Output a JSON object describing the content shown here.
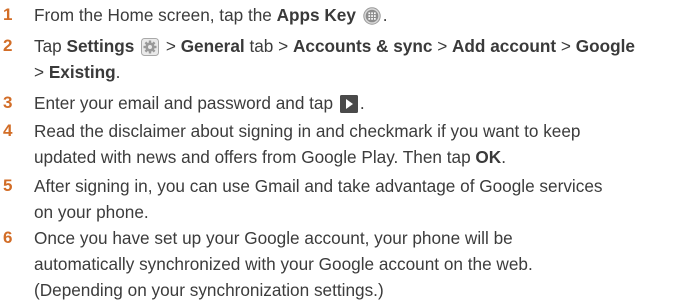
{
  "icons": {
    "apps_key": "apps-grid-icon",
    "settings": "settings-gear-icon",
    "next": "next-arrow-icon"
  },
  "colors": {
    "step_number": "#d26d27",
    "text": "#3c3c3c"
  },
  "steps": [
    {
      "number": "1",
      "line1_pre": "From the Home screen, tap the ",
      "apps_key": "Apps Key",
      "line1_post": "."
    },
    {
      "number": "2",
      "tap": "Tap ",
      "settings": "Settings",
      "sep1": " > ",
      "general": "General",
      "tab": " tab > ",
      "accounts": "Accounts & sync",
      "sep2": " > ",
      "add_account": "Add account",
      "sep3": " > ",
      "google": "Google",
      "sep4": "> ",
      "existing": "Existing",
      "end": "."
    },
    {
      "number": "3",
      "line1_pre": "Enter your email and password and tap ",
      "line1_post": "."
    },
    {
      "number": "4",
      "line1": "Read the disclaimer about signing in and checkmark if you want to keep",
      "line2_pre": "updated with news and offers from Google Play. Then tap ",
      "ok": "OK",
      "line2_post": "."
    },
    {
      "number": "5",
      "line1": "After signing in, you can use Gmail and take advantage of Google services",
      "line2": "on your phone."
    },
    {
      "number": "6",
      "line1": "Once you have set up your Google account, your phone will be",
      "line2": "automatically synchronized with your Google account on the web.",
      "line3": "(Depending on your synchronization settings.)"
    }
  ]
}
